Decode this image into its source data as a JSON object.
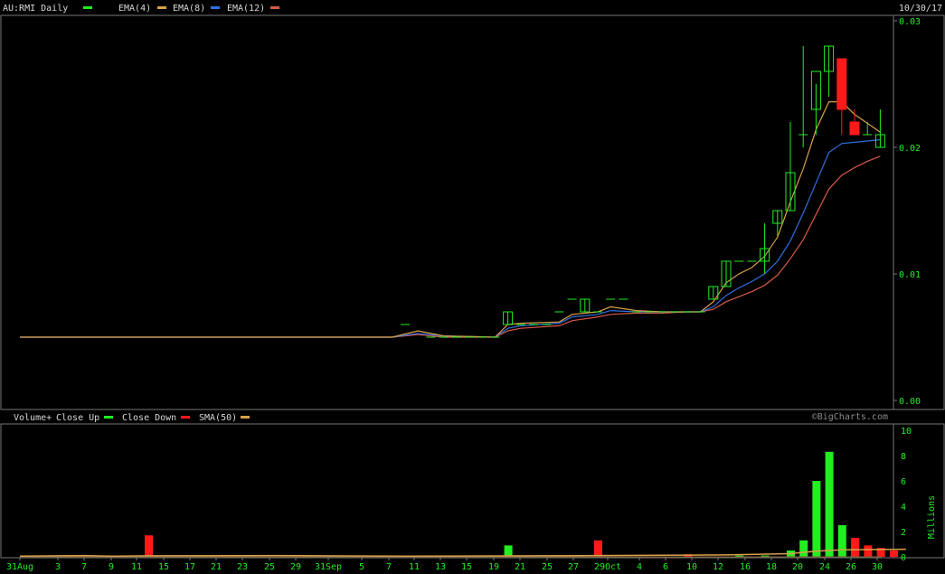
{
  "header": {
    "symbol_label": "AU:RMI Daily",
    "date": "10/30/17",
    "legend": [
      {
        "label": "EMA(4)",
        "color": "#d9a04a"
      },
      {
        "label": "EMA(8)",
        "color": "#2f6fe0"
      },
      {
        "label": "EMA(12)",
        "color": "#d65a4a"
      }
    ]
  },
  "volume_header": {
    "label": "Volume+",
    "close_up_label": "Close Up",
    "close_down_label": "Close Down",
    "sma_label": "SMA(50)",
    "watermark": "©BigCharts.com"
  },
  "colors": {
    "up": "#22ee22",
    "down": "#ff1a1a",
    "grid_text": "#22ee22",
    "frame": "#777777",
    "ema4": "#d9a04a",
    "ema8": "#2f6fe0",
    "ema12": "#d65a4a",
    "sma50": "#d9a04a"
  },
  "chart_data": {
    "type": "candlestick",
    "price_axis": {
      "ticks": [
        "0.03",
        "0.02",
        "0.01",
        "0.00"
      ],
      "min": 0,
      "max": 0.03
    },
    "volume_axis": {
      "ticks": [
        "10",
        "8",
        "6",
        "4",
        "2",
        "0"
      ],
      "min": 0,
      "max": 10,
      "unit_label": "Millions"
    },
    "x_tick_labels": [
      "31Aug",
      "3",
      "7",
      "9",
      "11",
      "15",
      "17",
      "21",
      "23",
      "25",
      "29",
      "31Sep",
      "5",
      "7",
      "11",
      "13",
      "15",
      "19",
      "21",
      "25",
      "27",
      "29Oct",
      "4",
      "6",
      "10",
      "12",
      "16",
      "18",
      "20",
      "24",
      "26",
      "30"
    ],
    "session_index_range": [
      0,
      67
    ],
    "bars": [
      {
        "i": 0,
        "o": 0.005,
        "h": 0.005,
        "l": 0.005,
        "c": 0.005
      },
      {
        "i": 30,
        "o": 0.006,
        "h": 0.006,
        "l": 0.006,
        "c": 0.006
      },
      {
        "i": 32,
        "o": 0.005,
        "h": 0.005,
        "l": 0.005,
        "c": 0.005
      },
      {
        "i": 33,
        "o": 0.005,
        "h": 0.005,
        "l": 0.005,
        "c": 0.005
      },
      {
        "i": 34,
        "o": 0.005,
        "h": 0.005,
        "l": 0.005,
        "c": 0.005
      },
      {
        "i": 35,
        "o": 0.005,
        "h": 0.005,
        "l": 0.005,
        "c": 0.005
      },
      {
        "i": 36,
        "o": 0.005,
        "h": 0.005,
        "l": 0.005,
        "c": 0.005
      },
      {
        "i": 37,
        "o": 0.005,
        "h": 0.005,
        "l": 0.005,
        "c": 0.005
      },
      {
        "i": 38,
        "o": 0.006,
        "h": 0.007,
        "l": 0.006,
        "c": 0.007
      },
      {
        "i": 39,
        "o": 0.006,
        "h": 0.006,
        "l": 0.006,
        "c": 0.006
      },
      {
        "i": 40,
        "o": 0.006,
        "h": 0.006,
        "l": 0.006,
        "c": 0.006
      },
      {
        "i": 41,
        "o": 0.006,
        "h": 0.006,
        "l": 0.006,
        "c": 0.006
      },
      {
        "i": 42,
        "o": 0.007,
        "h": 0.007,
        "l": 0.007,
        "c": 0.007
      },
      {
        "i": 43,
        "o": 0.008,
        "h": 0.008,
        "l": 0.008,
        "c": 0.008
      },
      {
        "i": 44,
        "o": 0.007,
        "h": 0.008,
        "l": 0.007,
        "c": 0.008
      },
      {
        "i": 45,
        "o": 0.007,
        "h": 0.007,
        "l": 0.007,
        "c": 0.007
      },
      {
        "i": 46,
        "o": 0.008,
        "h": 0.008,
        "l": 0.008,
        "c": 0.008
      },
      {
        "i": 47,
        "o": 0.008,
        "h": 0.008,
        "l": 0.008,
        "c": 0.008
      },
      {
        "i": 48,
        "o": 0.007,
        "h": 0.007,
        "l": 0.007,
        "c": 0.007
      },
      {
        "i": 49,
        "o": 0.007,
        "h": 0.007,
        "l": 0.007,
        "c": 0.007
      },
      {
        "i": 50,
        "o": 0.007,
        "h": 0.007,
        "l": 0.007,
        "c": 0.007
      },
      {
        "i": 51,
        "o": 0.007,
        "h": 0.007,
        "l": 0.007,
        "c": 0.007
      },
      {
        "i": 52,
        "o": 0.007,
        "h": 0.007,
        "l": 0.007,
        "c": 0.007
      },
      {
        "i": 53,
        "o": 0.007,
        "h": 0.007,
        "l": 0.007,
        "c": 0.007
      },
      {
        "i": 54,
        "o": 0.008,
        "h": 0.009,
        "l": 0.008,
        "c": 0.009
      },
      {
        "i": 55,
        "o": 0.009,
        "h": 0.011,
        "l": 0.009,
        "c": 0.011
      },
      {
        "i": 56,
        "o": 0.011,
        "h": 0.011,
        "l": 0.011,
        "c": 0.011
      },
      {
        "i": 57,
        "o": 0.011,
        "h": 0.011,
        "l": 0.011,
        "c": 0.011
      },
      {
        "i": 58,
        "o": 0.011,
        "h": 0.014,
        "l": 0.01,
        "c": 0.012
      },
      {
        "i": 59,
        "o": 0.014,
        "h": 0.015,
        "l": 0.013,
        "c": 0.015
      },
      {
        "i": 60,
        "o": 0.015,
        "h": 0.022,
        "l": 0.015,
        "c": 0.018
      },
      {
        "i": 61,
        "o": 0.021,
        "h": 0.028,
        "l": 0.02,
        "c": 0.021
      },
      {
        "i": 62,
        "o": 0.023,
        "h": 0.025,
        "l": 0.021,
        "c": 0.026
      },
      {
        "i": 63,
        "o": 0.026,
        "h": 0.028,
        "l": 0.024,
        "c": 0.028
      },
      {
        "i": 64,
        "o": 0.027,
        "h": 0.027,
        "l": 0.021,
        "c": 0.023
      },
      {
        "i": 65,
        "o": 0.022,
        "h": 0.023,
        "l": 0.021,
        "c": 0.021
      },
      {
        "i": 66,
        "o": 0.021,
        "h": 0.022,
        "l": 0.021,
        "c": 0.021
      },
      {
        "i": 67,
        "o": 0.02,
        "h": 0.023,
        "l": 0.02,
        "c": 0.021
      }
    ],
    "ema4": [
      [
        0,
        0.005
      ],
      [
        29,
        0.005
      ],
      [
        31,
        0.0055
      ],
      [
        33,
        0.0051
      ],
      [
        37,
        0.005
      ],
      [
        38,
        0.006
      ],
      [
        39,
        0.0061
      ],
      [
        42,
        0.0062
      ],
      [
        43,
        0.0068
      ],
      [
        45,
        0.007
      ],
      [
        46,
        0.0074
      ],
      [
        48,
        0.0071
      ],
      [
        50,
        0.007
      ],
      [
        52,
        0.007
      ],
      [
        53,
        0.007
      ],
      [
        54,
        0.0078
      ],
      [
        55,
        0.0093
      ],
      [
        56,
        0.01
      ],
      [
        57,
        0.0105
      ],
      [
        58,
        0.0114
      ],
      [
        59,
        0.0129
      ],
      [
        60,
        0.0157
      ],
      [
        61,
        0.0183
      ],
      [
        62,
        0.0214
      ],
      [
        63,
        0.0236
      ],
      [
        64,
        0.0236
      ],
      [
        65,
        0.0226
      ],
      [
        66,
        0.0219
      ],
      [
        67,
        0.0212
      ]
    ],
    "ema8": [
      [
        0,
        0.005
      ],
      [
        29,
        0.005
      ],
      [
        31,
        0.0053
      ],
      [
        33,
        0.0051
      ],
      [
        37,
        0.005
      ],
      [
        38,
        0.0057
      ],
      [
        39,
        0.0059
      ],
      [
        42,
        0.0061
      ],
      [
        43,
        0.0066
      ],
      [
        45,
        0.0068
      ],
      [
        46,
        0.0071
      ],
      [
        48,
        0.007
      ],
      [
        50,
        0.007
      ],
      [
        52,
        0.007
      ],
      [
        53,
        0.007
      ],
      [
        54,
        0.0074
      ],
      [
        55,
        0.0083
      ],
      [
        56,
        0.0089
      ],
      [
        57,
        0.0094
      ],
      [
        58,
        0.01
      ],
      [
        59,
        0.011
      ],
      [
        60,
        0.0126
      ],
      [
        61,
        0.0148
      ],
      [
        62,
        0.0172
      ],
      [
        63,
        0.0196
      ],
      [
        64,
        0.0203
      ],
      [
        65,
        0.0204
      ],
      [
        66,
        0.0205
      ],
      [
        67,
        0.0206
      ]
    ],
    "ema12": [
      [
        0,
        0.005
      ],
      [
        29,
        0.005
      ],
      [
        31,
        0.0052
      ],
      [
        33,
        0.005
      ],
      [
        37,
        0.005
      ],
      [
        38,
        0.0055
      ],
      [
        39,
        0.0057
      ],
      [
        42,
        0.0059
      ],
      [
        43,
        0.0063
      ],
      [
        45,
        0.0066
      ],
      [
        46,
        0.0068
      ],
      [
        48,
        0.0069
      ],
      [
        50,
        0.0069
      ],
      [
        52,
        0.007
      ],
      [
        53,
        0.007
      ],
      [
        54,
        0.0072
      ],
      [
        55,
        0.0078
      ],
      [
        56,
        0.0082
      ],
      [
        57,
        0.0086
      ],
      [
        58,
        0.0091
      ],
      [
        59,
        0.0099
      ],
      [
        60,
        0.0112
      ],
      [
        61,
        0.0127
      ],
      [
        62,
        0.0147
      ],
      [
        63,
        0.0167
      ],
      [
        64,
        0.0178
      ],
      [
        65,
        0.0184
      ],
      [
        66,
        0.0189
      ],
      [
        67,
        0.0193
      ]
    ],
    "volume": [
      {
        "i": 10,
        "v": 1.7,
        "dir": "down"
      },
      {
        "i": 38,
        "v": 0.9,
        "dir": "up"
      },
      {
        "i": 45,
        "v": 1.3,
        "dir": "down"
      },
      {
        "i": 52,
        "v": 0.2,
        "dir": "down"
      },
      {
        "i": 56,
        "v": 0.1,
        "dir": "up"
      },
      {
        "i": 58,
        "v": 0.1,
        "dir": "up"
      },
      {
        "i": 60,
        "v": 0.5,
        "dir": "up"
      },
      {
        "i": 61,
        "v": 1.3,
        "dir": "up"
      },
      {
        "i": 62,
        "v": 6.0,
        "dir": "up"
      },
      {
        "i": 63,
        "v": 8.3,
        "dir": "up"
      },
      {
        "i": 64,
        "v": 2.5,
        "dir": "up"
      },
      {
        "i": 65,
        "v": 0.9,
        "dir": "up"
      },
      {
        "i": 66,
        "v": 1.5,
        "dir": "down"
      },
      {
        "i": 67,
        "v": 0.9,
        "dir": "down"
      },
      {
        "i": 68,
        "v": 0.7,
        "dir": "down"
      },
      {
        "i": 69,
        "v": 0.5,
        "dir": "down"
      }
    ],
    "sma50": [
      [
        0,
        0.05
      ],
      [
        5,
        0.1
      ],
      [
        7,
        0.05
      ],
      [
        10,
        0.08
      ],
      [
        20,
        0.1
      ],
      [
        30,
        0.05
      ],
      [
        40,
        0.08
      ],
      [
        50,
        0.12
      ],
      [
        55,
        0.15
      ],
      [
        60,
        0.25
      ],
      [
        62,
        0.45
      ],
      [
        64,
        0.55
      ],
      [
        69,
        0.6
      ]
    ]
  }
}
